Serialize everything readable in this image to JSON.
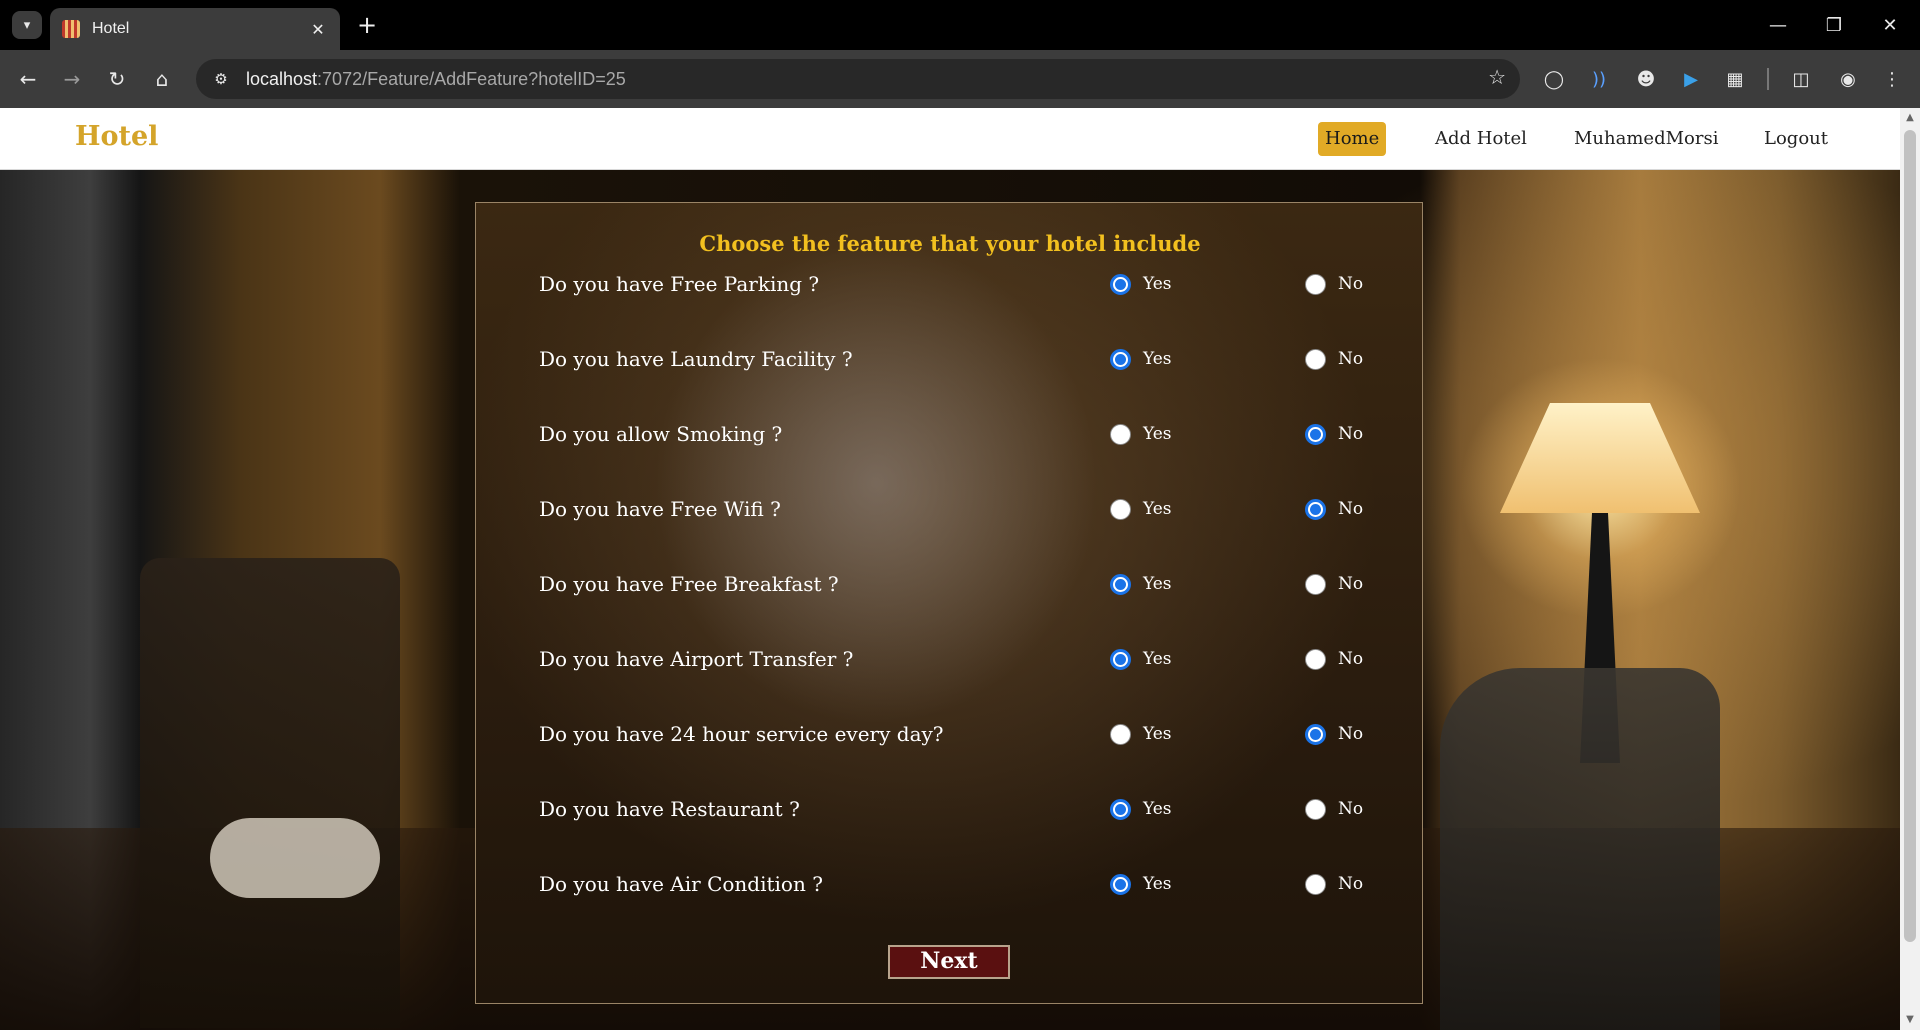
{
  "browser": {
    "tab_title": "Hotel",
    "url_host": "localhost",
    "url_path": ":7072/Feature/AddFeature?hotelID=25",
    "icons": {
      "tab_search": "chevron-down-icon",
      "tab_close": "close-icon",
      "new_tab": "plus-icon",
      "back": "back-arrow-icon",
      "forward": "forward-arrow-icon",
      "reload": "reload-icon",
      "home": "home-icon",
      "site_info": "site-info-icon",
      "bookmark": "star-icon",
      "extensions": "puzzle-icon",
      "side_panel": "side-panel-icon",
      "menu": "kebab-menu-icon"
    }
  },
  "navbar": {
    "brand": "Hotel",
    "links": [
      {
        "label": "Home",
        "active": true
      },
      {
        "label": "Add Hotel",
        "active": false
      },
      {
        "label": "MuhamedMorsi",
        "active": false
      },
      {
        "label": "Logout",
        "active": false
      }
    ]
  },
  "form": {
    "title": "Choose the feature that your hotel include",
    "yes_label": "Yes",
    "no_label": "No",
    "questions": [
      {
        "text": "Do you have Free Parking ?",
        "answer": "Yes"
      },
      {
        "text": "Do you have Laundry Facility ?",
        "answer": "Yes"
      },
      {
        "text": "Do you allow Smoking ?",
        "answer": "No"
      },
      {
        "text": "Do you have Free Wifi ?",
        "answer": "No"
      },
      {
        "text": "Do you have Free Breakfast ?",
        "answer": "Yes"
      },
      {
        "text": "Do you have Airport Transfer ?",
        "answer": "Yes"
      },
      {
        "text": "Do you have 24 hour service every day?",
        "answer": "No"
      },
      {
        "text": "Do you have Restaurant ?",
        "answer": "Yes"
      },
      {
        "text": "Do you have Air Condition ?",
        "answer": "Yes"
      }
    ],
    "submit_label": "Next"
  },
  "colors": {
    "brand": "#d4a42a",
    "active_nav": "#e1aa26",
    "form_title": "#f2c01f",
    "radio_checked": "#1a73e8",
    "next_button": "#5a1010"
  }
}
